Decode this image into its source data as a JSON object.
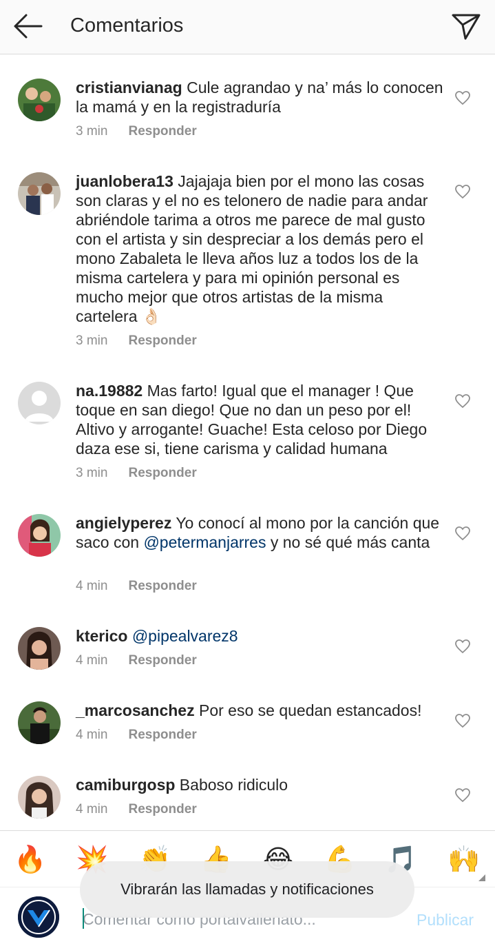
{
  "header": {
    "title": "Comentarios",
    "back_icon": "arrow-left-icon",
    "send_icon": "paper-plane-icon"
  },
  "comments": [
    {
      "username": "cristianvianag",
      "text": " Cule agrandao y na’ más lo conocen la mamá y en la registraduría",
      "time": "3 min",
      "reply": "Responder"
    },
    {
      "username": "juanlobera13",
      "text": " Jajajaja bien por el mono las cosas son claras y el no es telonero de nadie para andar abriéndole tarima a otros me parece de mal gusto con el artista y sin despreciar a los demás pero el mono Zabaleta le lleva años luz a todos los de la misma cartelera y para mi opinión personal es mucho mejor que otros artistas de la misma cartelera 👌🏻",
      "time": "3 min",
      "reply": "Responder"
    },
    {
      "username": "na.19882",
      "text": " Mas farto! Igual  que el manager ! Que toque en san diego! Que no dan un peso por el! Altivo y arrogante! Guache! Esta celoso por Diego daza ese si, tiene carisma y calidad humana",
      "time": "3 min",
      "reply": "Responder"
    },
    {
      "username": "angielyperez",
      "text_before": " Yo conocí al mono por la canción que saco con ",
      "mention": "@petermanjarres",
      "text_after": "  y no sé qué más canta",
      "time": "4 min",
      "reply": "Responder"
    },
    {
      "username": "kterico",
      "mention": "@pipealvarez8",
      "time": "4 min",
      "reply": "Responder"
    },
    {
      "username": "_marcosanchez",
      "text": " Por eso se quedan estancados!",
      "time": "4 min",
      "reply": "Responder"
    },
    {
      "username": "camiburgosp",
      "text": " Baboso ridiculo",
      "time": "4 min",
      "reply": "Responder"
    }
  ],
  "emoji_bar": [
    "🔥",
    "💥",
    "👏",
    "👍",
    "😂",
    "💪",
    "🎵",
    "🙌"
  ],
  "composer": {
    "placeholder": "Comentar como portalvallenato...",
    "publish_label": "Publicar"
  },
  "toast": {
    "text": "Vibrarán las llamadas y notificaciones"
  },
  "colors": {
    "mention": "#003569",
    "meta": "#8e8e8e",
    "publish_disabled": "#b2dffc"
  }
}
